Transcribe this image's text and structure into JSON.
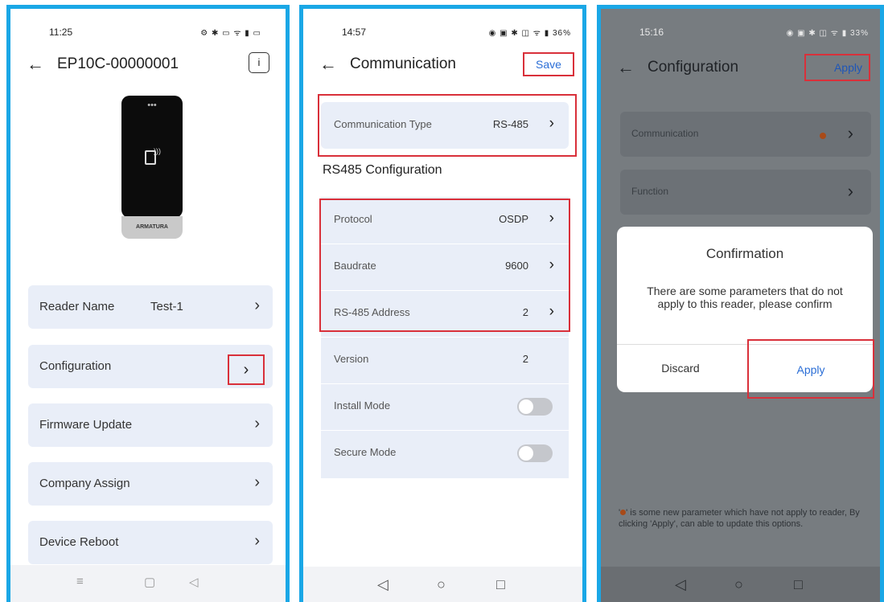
{
  "colors": {
    "frame": "#1aa7e6",
    "highlight": "#d9303a",
    "link": "#2b6ed6",
    "card": "#e9eef8",
    "new_param_dot": "#a84a18"
  },
  "screen1": {
    "status": {
      "time": "11:25",
      "icons": "⚙ ✱ ▭ ᯤ ▮ ▭"
    },
    "header": {
      "back": "←",
      "title": "EP10C-00000001",
      "info": "i"
    },
    "device": {
      "dots": "•••",
      "brand": "ARMATURA",
      "icon": "nfc-card-icon"
    },
    "items": [
      {
        "label": "Reader Name",
        "value": "Test-1",
        "chevron": "›"
      },
      {
        "label": "Configuration",
        "value": "",
        "chevron": "›"
      },
      {
        "label": "Firmware Update",
        "value": "",
        "chevron": "›"
      },
      {
        "label": "Company Assign",
        "value": "",
        "chevron": "›"
      },
      {
        "label": "Device Reboot",
        "value": "",
        "chevron": "›"
      }
    ],
    "nav": {
      "menu": "≡",
      "home": "▢",
      "back": "◁"
    }
  },
  "screen2": {
    "status": {
      "time": "14:57",
      "icons": "◉ ▣ ✱ ◫ ᯤ ▮ 36%"
    },
    "header": {
      "back": "←",
      "title": "Communication",
      "save": "Save"
    },
    "comm_type": {
      "label": "Communication Type",
      "value": "RS-485",
      "chevron": "›"
    },
    "section_title": "RS485 Configuration",
    "rows": [
      {
        "label": "Protocol",
        "value": "OSDP",
        "chevron": "›"
      },
      {
        "label": "Baudrate",
        "value": "9600",
        "chevron": "›"
      },
      {
        "label": "RS-485 Address",
        "value": "2",
        "chevron": "›"
      },
      {
        "label": "Version",
        "value": "2",
        "chevron": ""
      }
    ],
    "toggles": [
      {
        "label": "Install Mode",
        "on": false
      },
      {
        "label": "Secure Mode",
        "on": false
      }
    ],
    "nav": {
      "back": "◁",
      "home": "○",
      "recent": "□"
    }
  },
  "screen3": {
    "status": {
      "time": "15:16",
      "icons": "◉ ▣ ✱ ◫ ᯤ ▮ 33%"
    },
    "header": {
      "back": "←",
      "title": "Configuration",
      "apply": "Apply"
    },
    "items": [
      {
        "label": "Communication",
        "chevron": "›",
        "has_new": true
      },
      {
        "label": "Function",
        "chevron": "›",
        "has_new": false
      }
    ],
    "dialog": {
      "title": "Confirmation",
      "message": "There are some parameters that do not apply to this reader, please confirm",
      "discard": "Discard",
      "apply": "Apply"
    },
    "note_pre": "'",
    "note_text": "' is some new parameter which have not apply to reader, By clicking 'Apply', can able to update this options.",
    "nav": {
      "back": "◁",
      "home": "○",
      "recent": "□"
    }
  }
}
